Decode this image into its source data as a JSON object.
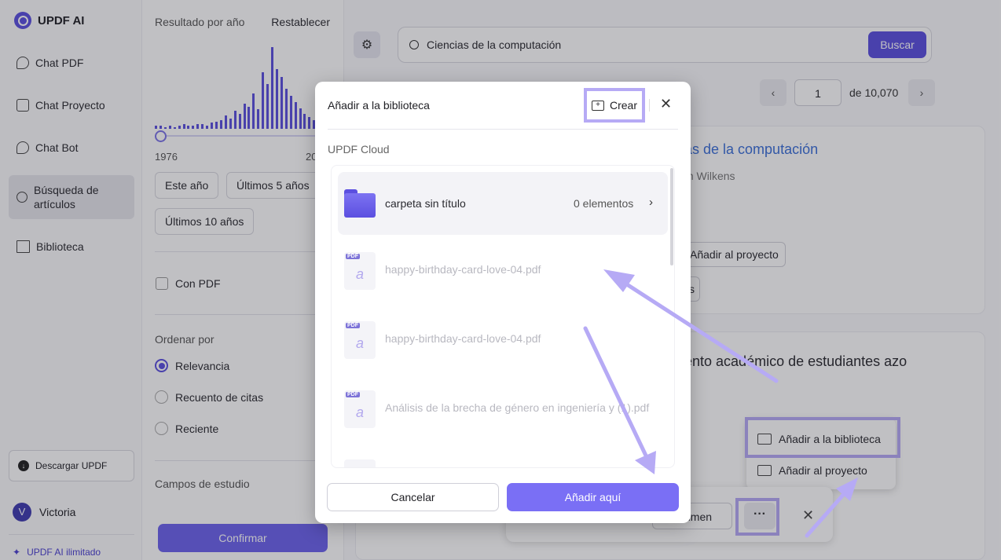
{
  "nav": {
    "brand": "UPDF AI",
    "items": [
      {
        "label": "Chat PDF"
      },
      {
        "label": "Chat Proyecto"
      },
      {
        "label": "Chat Bot"
      },
      {
        "label": "Búsqueda de artículos"
      },
      {
        "label": "Biblioteca"
      }
    ],
    "download_label": "Descargar UPDF",
    "user_name": "Victoria",
    "user_initial": "V",
    "plan_label": "UPDF AI ilimitado"
  },
  "filters": {
    "year_title": "Resultado por año",
    "reset_label": "Restablecer",
    "year_start": "1976",
    "year_end": "20",
    "histogram": [
      2,
      2,
      1,
      2,
      1,
      2,
      3,
      2,
      2,
      3,
      3,
      2,
      4,
      5,
      6,
      9,
      7,
      12,
      10,
      17,
      15,
      24,
      13,
      38,
      30,
      55,
      40,
      35,
      27,
      22,
      18,
      14,
      10,
      8,
      6,
      4,
      3,
      2
    ],
    "chips": [
      "Este año",
      "Últimos 5 años",
      "Últimos 10 años"
    ],
    "with_pdf_label": "Con PDF",
    "sort_title": "Ordenar por",
    "sort_options": [
      "Relevancia",
      "Recuento de citas",
      "Reciente"
    ],
    "sort_selected": 0,
    "fields_title": "Campos de estudio",
    "confirm_label": "Confirmar"
  },
  "main": {
    "search_value": "Ciencias de la computación",
    "search_button": "Buscar",
    "page_current": "1",
    "page_total": "de 10,070",
    "card1_title": "as de la computación",
    "card1_author": "m Wilkens",
    "card1_project_btn": "Añadir al proyecto",
    "card1_chip": "s",
    "card2_title": "ento académico de estudiantes azo",
    "menu_add_library": "Añadir a la biblioteca",
    "menu_add_project": "Añadir al proyecto",
    "resumen_label": "umen",
    "dots_label": "···"
  },
  "dialog": {
    "title": "Añadir a la biblioteca",
    "create_label": "Crear",
    "cloud_label": "UPDF Cloud",
    "folder": {
      "name": "carpeta sin título",
      "count": "0 elementos"
    },
    "files": [
      {
        "name": "happy-birthday-card-love-04.pdf"
      },
      {
        "name": "happy-birthday-card-love-04.pdf"
      },
      {
        "name": "Análisis de la brecha de género en ingeniería y (1).pdf"
      }
    ],
    "pdf_badge": "PDF",
    "cancel_label": "Cancelar",
    "add_here_label": "Añadir aquí"
  },
  "colors": {
    "accent": "#5b4fe0",
    "highlight": "#b6aaf5"
  }
}
